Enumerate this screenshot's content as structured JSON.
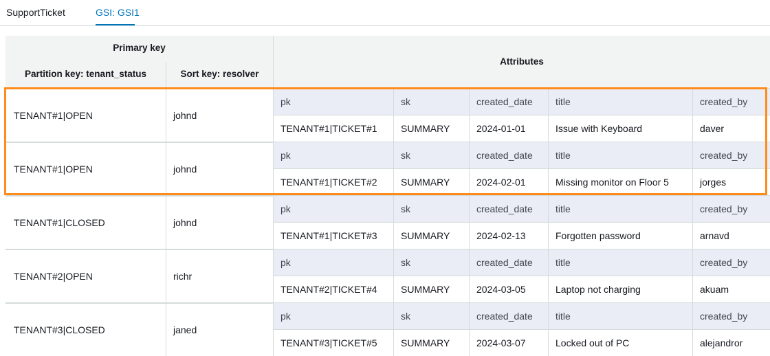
{
  "tabs": [
    {
      "label": "SupportTicket",
      "active": false
    },
    {
      "label": "GSI: GSI1",
      "active": true
    }
  ],
  "header": {
    "primary_key": "Primary key",
    "partition_key": "Partition key: tenant_status",
    "sort_key": "Sort key: resolver",
    "attributes": "Attributes"
  },
  "attribute_columns": [
    "pk",
    "sk",
    "created_date",
    "title",
    "created_by"
  ],
  "rows": [
    {
      "partition": "TENANT#1|OPEN",
      "sort": "johnd",
      "values": [
        "TENANT#1|TICKET#1",
        "SUMMARY",
        "2024-01-01",
        "Issue with Keyboard",
        "daver"
      ]
    },
    {
      "partition": "TENANT#1|OPEN",
      "sort": "johnd",
      "values": [
        "TENANT#1|TICKET#2",
        "SUMMARY",
        "2024-02-01",
        "Missing monitor on Floor 5",
        "jorges"
      ]
    },
    {
      "partition": "TENANT#1|CLOSED",
      "sort": "johnd",
      "values": [
        "TENANT#1|TICKET#3",
        "SUMMARY",
        "2024-02-13",
        "Forgotten password",
        "arnavd"
      ]
    },
    {
      "partition": "TENANT#2|OPEN",
      "sort": "richr",
      "values": [
        "TENANT#2|TICKET#4",
        "SUMMARY",
        "2024-03-05",
        "Laptop not charging",
        "akuam"
      ]
    },
    {
      "partition": "TENANT#3|CLOSED",
      "sort": "janed",
      "values": [
        "TENANT#3|TICKET#5",
        "SUMMARY",
        "2024-03-07",
        "Locked out of PC",
        "alejandror"
      ]
    }
  ],
  "highlight": {
    "color": "#ff8c1a"
  },
  "colors": {
    "header_bg": "#f2f3f3",
    "attr_label_bg": "#eaedf6",
    "tab_active": "#0073bb",
    "grid": "#d5dbdb"
  }
}
